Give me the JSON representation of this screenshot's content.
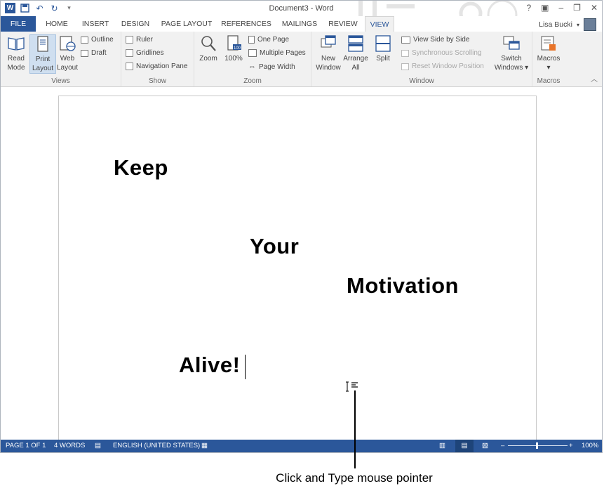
{
  "window": {
    "title": "Document3 - Word"
  },
  "quick_access": {
    "icons": [
      "word-logo-icon",
      "save-icon",
      "undo-icon",
      "redo-icon",
      "customize-icon"
    ]
  },
  "window_controls": {
    "help": "?",
    "ribbon_options": "▣",
    "minimize": "–",
    "restore": "❐",
    "close": "✕"
  },
  "tabs": [
    "FILE",
    "HOME",
    "INSERT",
    "DESIGN",
    "PAGE LAYOUT",
    "REFERENCES",
    "MAILINGS",
    "REVIEW",
    "VIEW"
  ],
  "active_tab": "VIEW",
  "user": {
    "name": "Lisa Bucki"
  },
  "ribbon": {
    "views": {
      "label": "Views",
      "read_mode": [
        "Read",
        "Mode"
      ],
      "print_layout": [
        "Print",
        "Layout"
      ],
      "web_layout": [
        "Web",
        "Layout"
      ],
      "outline": "Outline",
      "draft": "Draft"
    },
    "show": {
      "label": "Show",
      "ruler": "Ruler",
      "gridlines": "Gridlines",
      "navigation_pane": "Navigation Pane"
    },
    "zoom": {
      "label": "Zoom",
      "zoom": "Zoom",
      "hundred": "100%",
      "one_page": "One Page",
      "multiple_pages": "Multiple Pages",
      "page_width": "Page Width"
    },
    "window": {
      "label": "Window",
      "new_window": [
        "New",
        "Window"
      ],
      "arrange_all": [
        "Arrange",
        "All"
      ],
      "split": "Split",
      "view_side_by_side": "View Side by Side",
      "synchronous_scrolling": "Synchronous Scrolling",
      "reset_window_position": "Reset Window Position",
      "switch_windows": [
        "Switch",
        "Windows ▾"
      ]
    },
    "macros": {
      "label": "Macros",
      "macros": [
        "Macros",
        "▾"
      ]
    }
  },
  "document": {
    "words": [
      "Keep",
      "Your",
      "Motivation",
      "Alive!"
    ]
  },
  "status_bar": {
    "page": "PAGE 1 OF 1",
    "words": "4 WORDS",
    "language": "ENGLISH (UNITED STATES)",
    "zoom": "100%",
    "zoom_minus": "–",
    "zoom_plus": "+"
  },
  "callout": {
    "text": "Click and Type mouse pointer"
  },
  "colors": {
    "accent": "#2b579a",
    "status_bar": "#2b579a",
    "page": "#ffffff"
  }
}
